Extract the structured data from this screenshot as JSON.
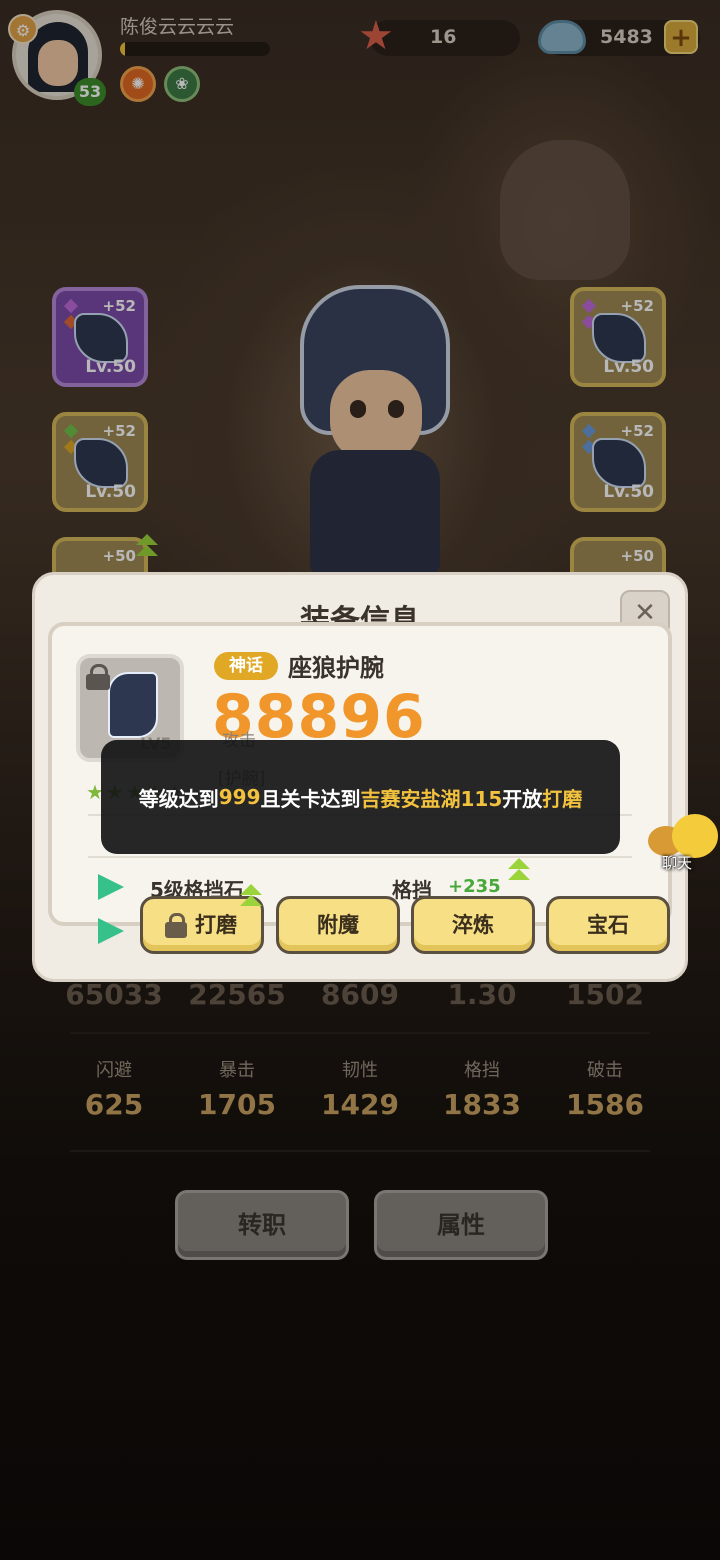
{
  "player": {
    "name": "陈俊云云云云",
    "level": "53",
    "xp_fraction": 0.03
  },
  "resources": {
    "starfish_count": "16",
    "shell_count": "5483",
    "add_label": "+"
  },
  "equipment_slots": {
    "left": [
      {
        "plus": "+52",
        "level": "Lv.50",
        "frame": "purple"
      },
      {
        "plus": "+52",
        "level": "Lv.50",
        "frame": "gold"
      },
      {
        "plus": "+50",
        "level": "",
        "frame": "gold"
      }
    ],
    "right": [
      {
        "plus": "+52",
        "level": "Lv.50",
        "frame": "gold"
      },
      {
        "plus": "+52",
        "level": "Lv.50",
        "frame": "gold"
      },
      {
        "plus": "+50",
        "level": "",
        "frame": "gold"
      }
    ]
  },
  "chat": {
    "label": "聊天"
  },
  "modal": {
    "title": "装备信息",
    "close_label": "✕",
    "item": {
      "rarity": "神话",
      "name": "座狼护腕",
      "power": "88896",
      "attr_label": "攻击",
      "slot_type": "[护腕]",
      "level": "LV5",
      "stars": "★★★★★"
    },
    "gem_row": {
      "name": "5级格挡石",
      "stat_name": "格挡",
      "stat_value": "+235"
    },
    "actions": [
      "打磨",
      "附魔",
      "淬炼",
      "宝石"
    ]
  },
  "toast": {
    "part1": "等级达到",
    "level": "999",
    "part2": "且关卡达到",
    "stage": "吉赛安盐湖115",
    "part3": "开放",
    "feature": "打磨"
  },
  "stats": {
    "top_values": [
      "65033",
      "22565",
      "8609",
      "1.30",
      "1502"
    ],
    "labels": [
      "闪避",
      "暴击",
      "韧性",
      "格挡",
      "破击"
    ],
    "values": [
      "625",
      "1705",
      "1429",
      "1833",
      "1586"
    ]
  },
  "bottom_buttons": {
    "transfer": "转职",
    "attributes": "属性"
  },
  "colors": {
    "accent_gold": "#f2c23e",
    "power_orange": "#f0962a",
    "rarity_badge": "#e0a825",
    "stat_gain_green": "#48a83a"
  }
}
